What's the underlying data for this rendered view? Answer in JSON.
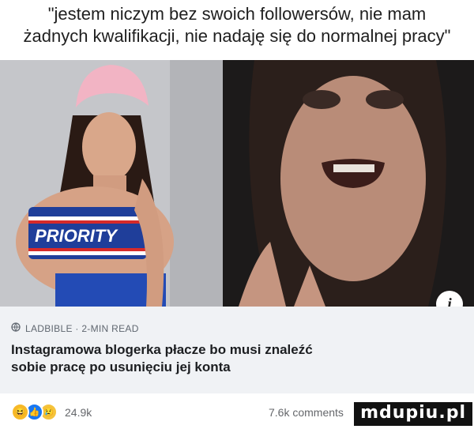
{
  "caption": {
    "line1": "\"jestem niczym bez swoich followersów, nie mam",
    "line2": "żadnych kwalifikacji, nie nadaję się do normalnej pracy\""
  },
  "left_photo": {
    "shirt_text": "PRIORITY",
    "bg_color": "#c7c8cc",
    "hat_color": "#f2b4c4",
    "top_color": "#1f3e9a"
  },
  "right_photo": {
    "bg_color": "#1c1a1a"
  },
  "info_badge": "i",
  "link_card": {
    "source": "LADBIBLE · 2-MIN READ",
    "headline_line1": "Instagramowa blogerka płacze bo musi znaleźć",
    "headline_line2": "sobie pracę po usunięciu jej konta"
  },
  "stats": {
    "reaction_count": "24.9k",
    "comments": "7.6k comments",
    "reactions": [
      "haha",
      "like",
      "sad"
    ]
  },
  "watermark": "mdupiu.pl",
  "icons": {
    "globe": "globe-icon",
    "haha": "haha-reaction-icon",
    "like": "like-reaction-icon",
    "sad": "sad-reaction-icon"
  }
}
